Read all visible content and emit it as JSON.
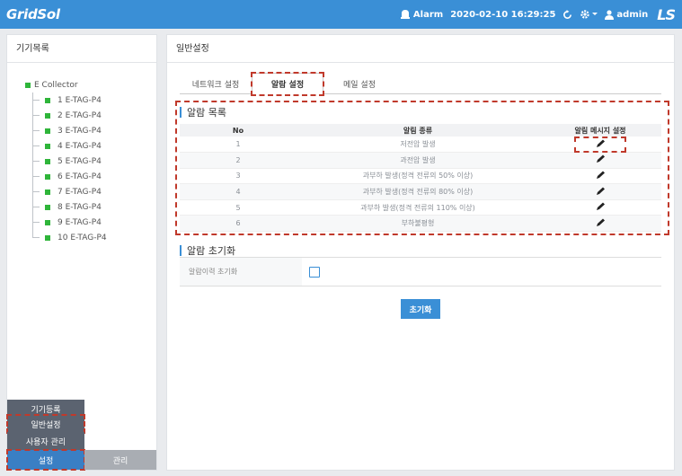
{
  "header": {
    "logo": "GridSol",
    "alarm_label": "Alarm",
    "datetime": "2020-02-10 16:29:25",
    "user": "admin",
    "brand": "LS"
  },
  "left_panel": {
    "title": "기기목록",
    "root": "E Collector",
    "devices": [
      "1 E-TAG-P4",
      "2 E-TAG-P4",
      "3 E-TAG-P4",
      "4 E-TAG-P4",
      "5 E-TAG-P4",
      "6 E-TAG-P4",
      "7 E-TAG-P4",
      "8 E-TAG-P4",
      "9 E-TAG-P4",
      "10 E-TAG-P4"
    ],
    "menu": {
      "device_register": "기기등록",
      "general_settings": "일반설정",
      "user_management": "사용자 관리",
      "settings": "설정",
      "admin": "관리"
    }
  },
  "main": {
    "title": "일반설정",
    "tabs": [
      "네트워크 설정",
      "알람 설정",
      "메일 설정"
    ],
    "alarm_list_title": "알람 목록",
    "table_headers": [
      "No",
      "알림 종류",
      "알림 메시지 설정"
    ],
    "rows": [
      {
        "no": "1",
        "type": "저전압 발생"
      },
      {
        "no": "2",
        "type": "과전압 발생"
      },
      {
        "no": "3",
        "type": "과부하 발생(정격 전류의 50% 이상)"
      },
      {
        "no": "4",
        "type": "과부하 발생(정격 전류의 80% 이상)"
      },
      {
        "no": "5",
        "type": "과부하 발생(정격 전류의 110% 이상)"
      },
      {
        "no": "6",
        "type": "부하불평형"
      }
    ],
    "reset_section_title": "알람 초기화",
    "reset_label": "알람이력 초기화",
    "reset_button": "초기화"
  },
  "colors": {
    "header": "#3a8fd6",
    "status_green": "#2fb53a",
    "menu_dark": "#5b6370",
    "menu_active": "#3a7fc4",
    "highlight": "#c0392b"
  },
  "icons": [
    "alarm-bell-icon",
    "refresh-icon",
    "gear-icon",
    "user-icon",
    "pencil-icon"
  ]
}
